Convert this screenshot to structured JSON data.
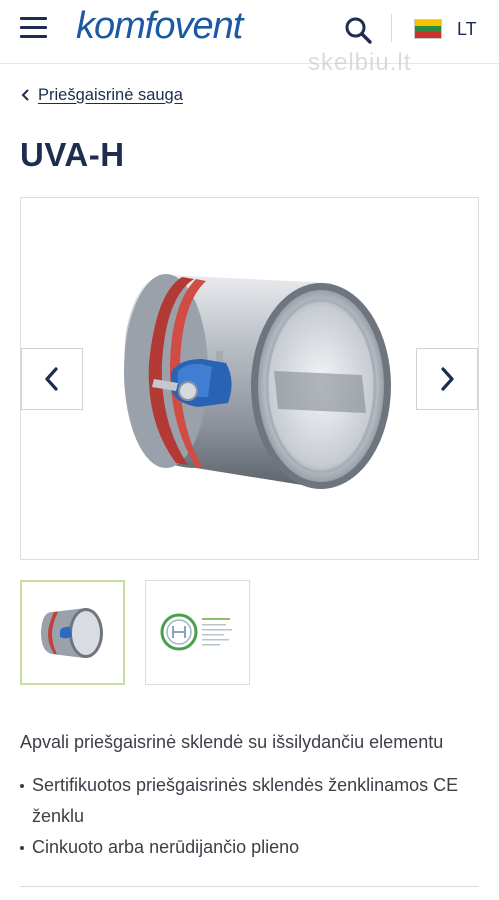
{
  "header": {
    "logo_text": "komfovent",
    "language": "LT",
    "watermark": "skelbiu.lt",
    "icons": {
      "menu": "hamburger-icon",
      "search": "search-icon",
      "flag": "lithuania-flag-icon"
    }
  },
  "breadcrumb": {
    "label": "Priešgaisrinė sauga"
  },
  "product": {
    "title": "UVA-H",
    "description": "Apvali priešgaisrinė sklendė su išsilydančiu elementu",
    "features": [
      "Sertifikuotos priešgaisrinės sklendės ženklinamos CE ženklu",
      "Cinkuoto arba nerūdijančio plieno"
    ]
  },
  "gallery": {
    "active_index": 0,
    "thumbnails": [
      "product-photo",
      "certificate"
    ]
  },
  "colors": {
    "brand_blue": "#1b5aa3",
    "navy": "#1e2d4f",
    "thumb_active_border": "#c9dca0"
  }
}
